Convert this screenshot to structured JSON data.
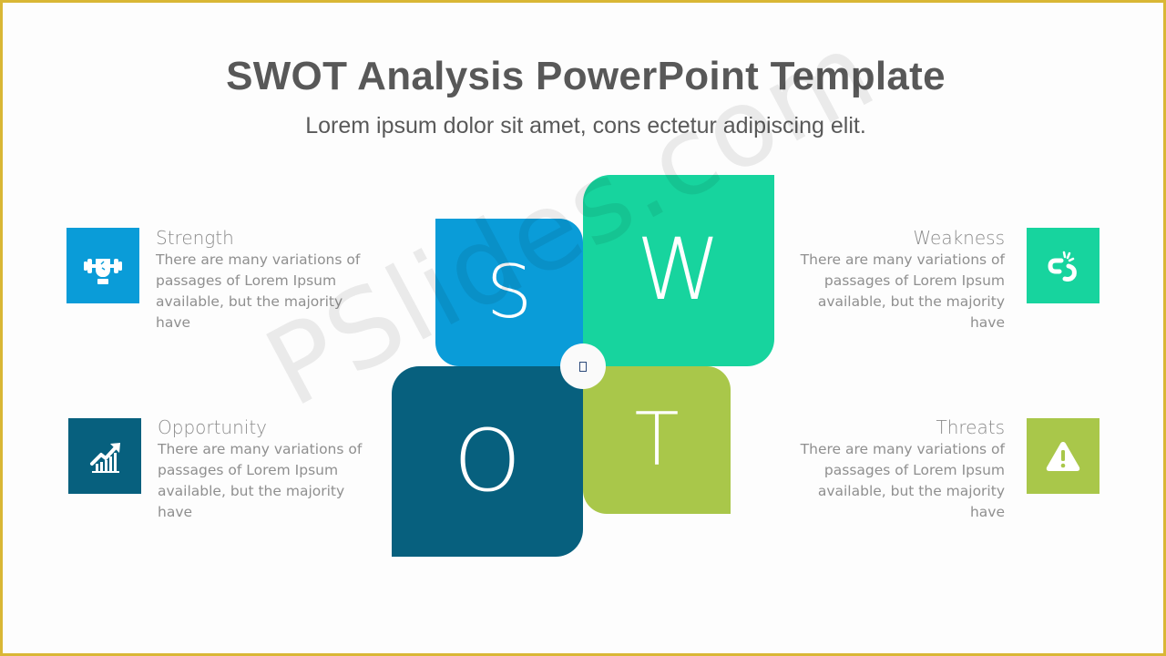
{
  "slide": {
    "title": "SWOT Analysis PowerPoint Template",
    "subtitle": "Lorem ipsum dolor sit amet, cons ectetur adipiscing elit.",
    "watermark": "PSlides.com",
    "frame_color": "#d9b735"
  },
  "quadrants": [
    {
      "key": "strength",
      "letter": "S",
      "heading": "Strength",
      "body": "There are many variations of passages of Lorem Ipsum available, but the majority have",
      "color": "#0a9cd8",
      "icon": "dumbbell-fist-icon"
    },
    {
      "key": "weakness",
      "letter": "W",
      "heading": "Weakness",
      "body": "There are many variations of passages of Lorem Ipsum available, but the majority have",
      "color": "#17d49e",
      "icon": "broken-link-icon"
    },
    {
      "key": "opportunity",
      "letter": "O",
      "heading": "Opportunity",
      "body": "There are many variations of passages of Lorem Ipsum available, but the majority have",
      "color": "#07607e",
      "icon": "growth-chart-icon"
    },
    {
      "key": "threats",
      "letter": "T",
      "heading": "Threats",
      "body": "There are many variations of passages of Lorem Ipsum available, but the majority have",
      "color": "#a9c74a",
      "icon": "warning-triangle-icon"
    }
  ],
  "center": {
    "icon": "missing-glyph-icon"
  }
}
